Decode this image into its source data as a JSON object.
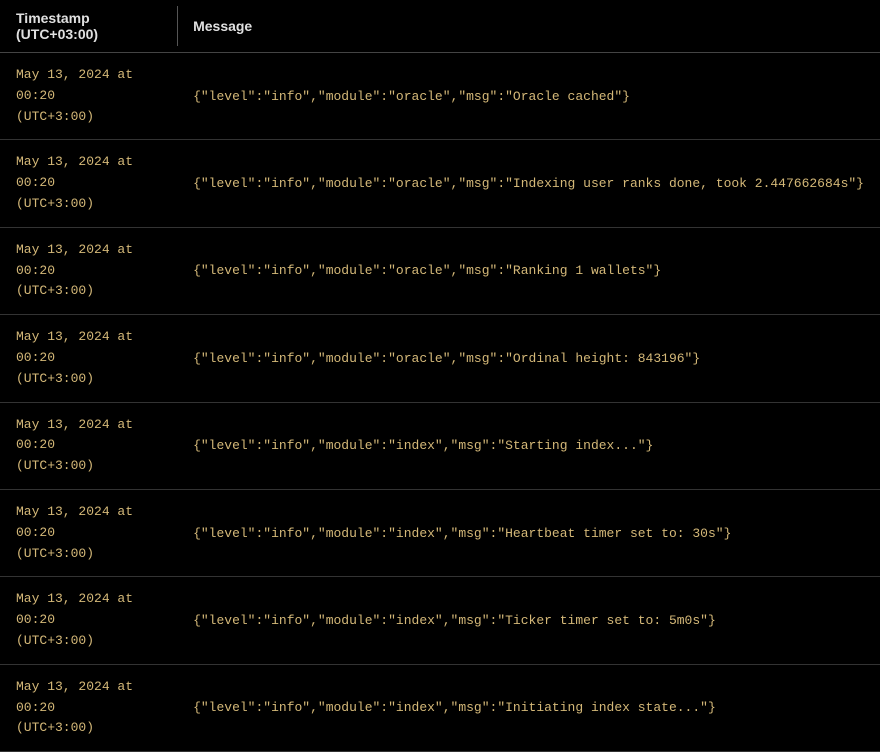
{
  "headers": {
    "timestamp": "Timestamp (UTC+03:00)",
    "message": "Message"
  },
  "logs": [
    {
      "timestamp_line1": "May 13, 2024 at 00:20",
      "timestamp_line2": "(UTC+3:00)",
      "message": "{\"level\":\"info\",\"module\":\"oracle\",\"msg\":\"Oracle cached\"}"
    },
    {
      "timestamp_line1": "May 13, 2024 at 00:20",
      "timestamp_line2": "(UTC+3:00)",
      "message": "{\"level\":\"info\",\"module\":\"oracle\",\"msg\":\"Indexing user ranks done, took 2.447662684s\"}"
    },
    {
      "timestamp_line1": "May 13, 2024 at 00:20",
      "timestamp_line2": "(UTC+3:00)",
      "message": "{\"level\":\"info\",\"module\":\"oracle\",\"msg\":\"Ranking 1 wallets\"}"
    },
    {
      "timestamp_line1": "May 13, 2024 at 00:20",
      "timestamp_line2": "(UTC+3:00)",
      "message": "{\"level\":\"info\",\"module\":\"oracle\",\"msg\":\"Ordinal height: 843196\"}"
    },
    {
      "timestamp_line1": "May 13, 2024 at 00:20",
      "timestamp_line2": "(UTC+3:00)",
      "message": "{\"level\":\"info\",\"module\":\"index\",\"msg\":\"Starting index...\"}"
    },
    {
      "timestamp_line1": "May 13, 2024 at 00:20",
      "timestamp_line2": "(UTC+3:00)",
      "message": "{\"level\":\"info\",\"module\":\"index\",\"msg\":\"Heartbeat timer set to: 30s\"}"
    },
    {
      "timestamp_line1": "May 13, 2024 at 00:20",
      "timestamp_line2": "(UTC+3:00)",
      "message": "{\"level\":\"info\",\"module\":\"index\",\"msg\":\"Ticker timer set to: 5m0s\"}"
    },
    {
      "timestamp_line1": "May 13, 2024 at 00:20",
      "timestamp_line2": "(UTC+3:00)",
      "message": "{\"level\":\"info\",\"module\":\"index\",\"msg\":\"Initiating index state...\"}"
    }
  ]
}
